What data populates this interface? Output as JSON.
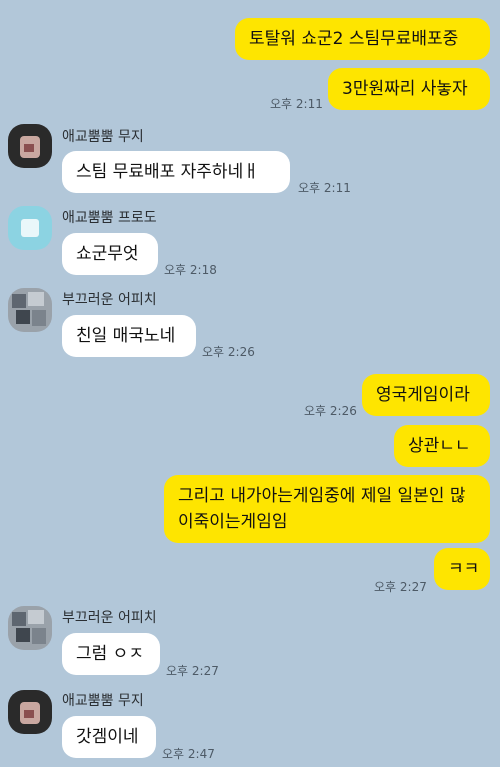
{
  "messages": [
    {
      "text": "토탈워 쇼군2  스팀무료배포중"
    },
    {
      "text": "3만원짜리 사놓자",
      "time": "오후 2:11"
    },
    {
      "sender": "애교뿜뿜 무지",
      "text": "스팀 무료배포 자주하네ㅐ",
      "time": "오후 2:11"
    },
    {
      "sender": "애교뿜뿜 프로도",
      "text": "쇼군무엇",
      "time": "오후 2:18"
    },
    {
      "sender": "부끄러운 어피치",
      "text": "친일 매국노네",
      "time": "오후 2:26"
    },
    {
      "text": "영국게임이라",
      "time": "오후 2:26"
    },
    {
      "text": "상관ㄴㄴ"
    },
    {
      "text": "그리고 내가아는게임중에 제일 일본인 많이죽이는게임임"
    },
    {
      "text": "ㅋㅋ",
      "time": "오후 2:27"
    },
    {
      "sender": "부끄러운 어피치",
      "text": "그럼 ㅇㅈ",
      "time": "오후 2:27"
    },
    {
      "sender": "애교뿜뿜 무지",
      "text": "갓겜이네",
      "time": "오후 2:47"
    }
  ]
}
